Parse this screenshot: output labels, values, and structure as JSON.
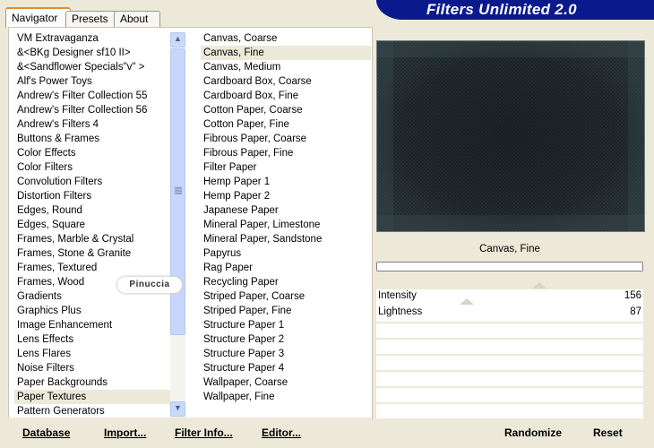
{
  "window": {
    "title": "Filters Unlimited 2.0"
  },
  "tabs": [
    {
      "label": "Navigator",
      "active": true
    },
    {
      "label": "Presets",
      "active": false
    },
    {
      "label": "About",
      "active": false
    }
  ],
  "categories": [
    "VM Extravaganza",
    "&<BKg Designer sf10 II>",
    "&<Sandflower Specials\"v\" >",
    "Alf's Power Toys",
    "Andrew's Filter Collection 55",
    "Andrew's Filter Collection 56",
    "Andrew's Filters 4",
    "Buttons & Frames",
    "Color Effects",
    "Color Filters",
    "Convolution Filters",
    "Distortion Filters",
    "Edges, Round",
    "Edges, Square",
    "Frames, Marble & Crystal",
    "Frames, Stone & Granite",
    "Frames, Textured",
    "Frames, Wood",
    "Gradients",
    "Graphics Plus",
    "Image Enhancement",
    "Lens Effects",
    "Lens Flares",
    "Noise Filters",
    "Paper Backgrounds",
    "Paper Textures",
    "Pattern Generators"
  ],
  "selected_category": "Paper Textures",
  "filters": [
    "Canvas, Coarse",
    "Canvas, Fine",
    "Canvas, Medium",
    "Cardboard Box, Coarse",
    "Cardboard Box, Fine",
    "Cotton Paper, Coarse",
    "Cotton Paper, Fine",
    "Fibrous Paper, Coarse",
    "Fibrous Paper, Fine",
    "Filter Paper",
    "Hemp Paper 1",
    "Hemp Paper 2",
    "Japanese Paper",
    "Mineral Paper, Limestone",
    "Mineral Paper, Sandstone",
    "Papyrus",
    "Rag Paper",
    "Recycling Paper",
    "Striped Paper, Coarse",
    "Striped Paper, Fine",
    "Structure Paper 1",
    "Structure Paper 2",
    "Structure Paper 3",
    "Structure Paper 4",
    "Wallpaper, Coarse",
    "Wallpaper, Fine"
  ],
  "selected_filter": "Canvas, Fine",
  "preview": {
    "current_filter": "Canvas, Fine"
  },
  "sliders": [
    {
      "label": "Intensity",
      "value": "156",
      "fraction": 0.61
    },
    {
      "label": "Lightness",
      "value": "87",
      "fraction": 0.34
    }
  ],
  "watermark": {
    "text": "Pinuccia"
  },
  "buttons": {
    "database": "Database",
    "import": "Import...",
    "filter_info": "Filter Info...",
    "editor": "Editor...",
    "randomize": "Randomize",
    "reset": "Reset"
  },
  "icons": {
    "scroll_up": "chevron-up-icon",
    "scroll_down": "chevron-down-icon"
  },
  "colors": {
    "banner": "#0a1a8c",
    "preview_bg": "#222a2d",
    "tab_highlight": "#e68b2c"
  }
}
